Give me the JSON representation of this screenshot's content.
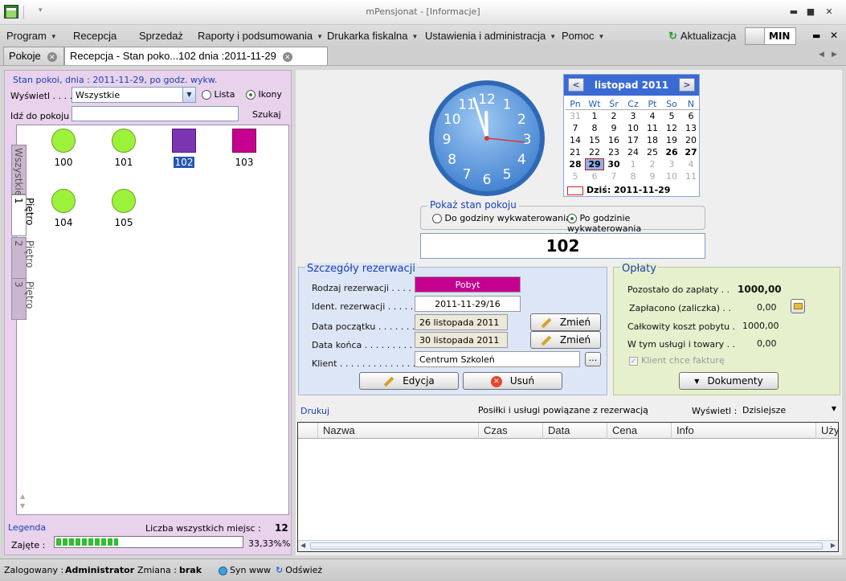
{
  "window": {
    "title": "mPensjonat - [Informacje]"
  },
  "menu": {
    "items": [
      "Program",
      "Recepcja",
      "Sprzedaż",
      "Raporty i podsumowania",
      "Drukarka fiskalna",
      "Ustawienia i administracja",
      "Pomoc"
    ],
    "update_label": "Aktualizacja",
    "min_label": "MIN"
  },
  "tabs": [
    {
      "label": "Pokoje"
    },
    {
      "label": "Recepcja - Stan poko...102 dnia :2011-11-29"
    }
  ],
  "left": {
    "header": "Stan pokoi, dnia : 2011-11-29, po godz. wykw.",
    "show_label": "Wyświetl . . . .",
    "show_value": "Wszystkie",
    "view_list": "Lista",
    "view_icons": "Ikony",
    "goto_label": "Idź do pokoju",
    "goto_value": "",
    "search_label": "Szukaj",
    "rooms": [
      {
        "number": "100",
        "state": "free-circle"
      },
      {
        "number": "101",
        "state": "free-circle"
      },
      {
        "number": "102",
        "state": "occupied-purple",
        "selected": true
      },
      {
        "number": "103",
        "state": "reserved-magenta"
      },
      {
        "number": "104",
        "state": "free-circle"
      },
      {
        "number": "105",
        "state": "free-circle"
      }
    ],
    "vtabs": [
      "Wszystkie",
      "Piętro 1",
      "Piętro 2",
      "Piętro 3"
    ],
    "legend_label": "Legenda",
    "total_label": "Liczba wszystkich miejsc :",
    "total_value": "12",
    "occupied_label": "Zajęte :",
    "occupied_percent": "33,33%%",
    "occupied_fraction": 0.3333
  },
  "clock": {
    "numbers": [
      "12",
      "1",
      "2",
      "3",
      "4",
      "5",
      "6",
      "7",
      "8",
      "9",
      "10",
      "11"
    ],
    "hour": 11,
    "minute": 57,
    "second": 16
  },
  "calendar": {
    "month_title": "listopad 2011",
    "prev": "<",
    "next": ">",
    "day_headers": [
      "Pn",
      "Wt",
      "Śr",
      "Cz",
      "Pt",
      "So",
      "N"
    ],
    "weeks": [
      [
        "31",
        "1",
        "2",
        "3",
        "4",
        "5",
        "6"
      ],
      [
        "7",
        "8",
        "9",
        "10",
        "11",
        "12",
        "13"
      ],
      [
        "14",
        "15",
        "16",
        "17",
        "18",
        "19",
        "20"
      ],
      [
        "21",
        "22",
        "23",
        "24",
        "25",
        "26",
        "27"
      ],
      [
        "28",
        "29",
        "30",
        "1",
        "2",
        "3",
        "4"
      ],
      [
        "5",
        "6",
        "7",
        "8",
        "9",
        "10",
        "11"
      ]
    ],
    "today_label": "Dziś: 2011-11-29"
  },
  "room_state": {
    "title": "Pokaż stan pokoju",
    "option_before": "Do godziny wykwaterowania",
    "option_after": "Po godzinie wykwaterowania",
    "room_number": "102"
  },
  "details": {
    "title": "Szczegóły rezerwacji",
    "type_label": "Rodzaj rezerwacji . . . . . .",
    "type_value": "Pobyt",
    "ident_label": "Ident. rezerwacji . . . . . . .",
    "ident_value": "2011-11-29/16",
    "start_label": "Data początku . . . . . . . .",
    "start_value": "26 listopada 2011",
    "end_label": "Data końca . . . . . . . . . .",
    "end_value": "30 listopada 2011",
    "client_label": "Klient . . . . . . . . . . . . . .",
    "client_value": "Centrum Szkoleń",
    "browse": "...",
    "change_label": "Zmień",
    "edit_label": "Edycja",
    "delete_label": "Usuń"
  },
  "payments": {
    "title": "Opłaty",
    "remaining_label": "Pozostało do zapłaty . .",
    "remaining_value": "1000,00",
    "paid_label": "Zapłacono (zaliczka) . .",
    "paid_value": "0,00",
    "total_label": "Całkowity koszt pobytu .",
    "total_value": "1000,00",
    "services_label": "W tym usługi i towary . .",
    "services_value": "0,00",
    "invoice_label": "Klient chce fakturę",
    "documents_label": "Dokumenty"
  },
  "services": {
    "print_label": "Drukuj",
    "title": "Posiłki i usługi powiązane z rezerwacją",
    "show_label": "Wyświetl :",
    "show_value": "Dzisiejsze",
    "columns": [
      "Nazwa",
      "Czas",
      "Data",
      "Cena",
      "Info",
      "Uży"
    ]
  },
  "status": {
    "logged_label": "Zalogowany :",
    "logged_value": "Administrator",
    "shift_label": "Zmiana :",
    "shift_value": "brak",
    "sync_label": "Syn www",
    "refresh_label": "Odśwież"
  },
  "colors": {
    "left_panel_bg": "#e8d2ec",
    "free_room": "#9cf23a",
    "occupied_room": "#7a36b2",
    "reserved_room": "#c6008e",
    "calendar_header": "#3a6bd4"
  }
}
